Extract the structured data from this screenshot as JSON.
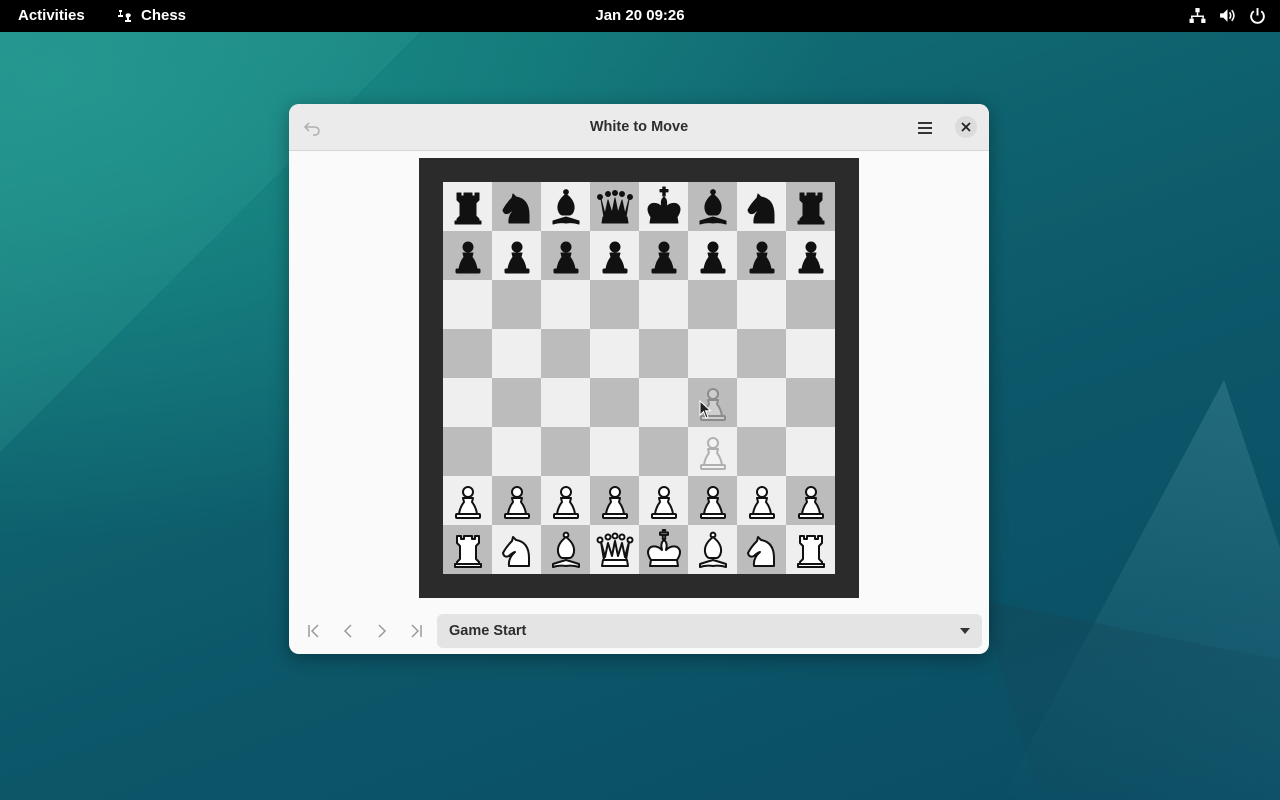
{
  "topbar": {
    "activities": "Activities",
    "app_name": "Chess",
    "clock": "Jan 20  09:26",
    "icons": [
      "network-icon",
      "volume-icon",
      "power-icon"
    ]
  },
  "window": {
    "title": "White to Move",
    "history_selected": "Game Start"
  },
  "board": {
    "ranks": [
      [
        "r",
        "n",
        "b",
        "q",
        "k",
        "b",
        "n",
        "r"
      ],
      [
        "p",
        "p",
        "p",
        "p",
        "p",
        "p",
        "p",
        "p"
      ],
      [
        "",
        "",
        "",
        "",
        "",
        "",
        "",
        ""
      ],
      [
        "",
        "",
        "",
        "",
        "",
        "",
        "",
        ""
      ],
      [
        "",
        "",
        "",
        "",
        "",
        "ghostP",
        "",
        ""
      ],
      [
        "",
        "",
        "",
        "",
        "",
        "ghostP",
        "",
        ""
      ],
      [
        "P",
        "P",
        "P",
        "P",
        "P",
        "P",
        "P",
        "P"
      ],
      [
        "R",
        "N",
        "B",
        "Q",
        "K",
        "B",
        "N",
        "R"
      ]
    ],
    "light_color": "#efefef",
    "dark_color": "#bcbcbc",
    "frame_color": "#2b2b2b"
  }
}
